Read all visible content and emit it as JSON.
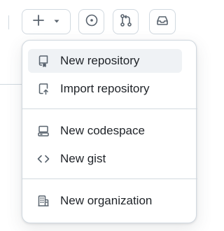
{
  "menu": {
    "items": [
      {
        "label": "New repository",
        "icon": "repo-icon",
        "active": true
      },
      {
        "label": "Import repository",
        "icon": "repo-push-icon",
        "active": false
      },
      {
        "label": "New codespace",
        "icon": "codespaces-icon",
        "active": false
      },
      {
        "label": "New gist",
        "icon": "code-icon",
        "active": false
      },
      {
        "label": "New organization",
        "icon": "organization-icon",
        "active": false
      }
    ]
  },
  "toolbar": {
    "create_icon": "plus-icon",
    "dropdown_icon": "triangle-down-icon",
    "issues_icon": "issue-opened-icon",
    "pulls_icon": "git-pull-request-icon",
    "inbox_icon": "inbox-icon"
  },
  "colors": {
    "text": "#1f2328",
    "muted": "#59636e",
    "border": "#d1d9e0",
    "active_bg": "#eff2f5"
  }
}
